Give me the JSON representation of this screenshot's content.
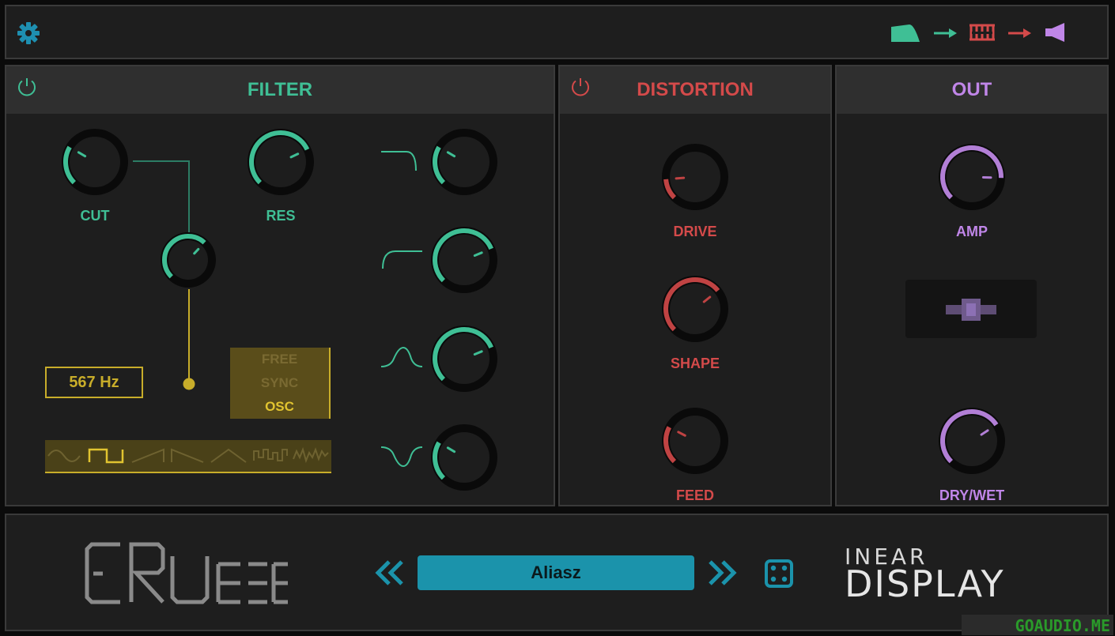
{
  "app": {
    "settings_icon": "gear-icon",
    "routing": [
      "filter-shape-icon",
      "arrow-right-icon",
      "distortion-comb-icon",
      "arrow-right-icon",
      "speaker-icon"
    ]
  },
  "filter": {
    "title": "FILTER",
    "power_icon": "power-icon",
    "cut_label": "CUT",
    "res_label": "RES",
    "cut_value": 0.28,
    "res_value": 0.74,
    "mod_amount": 0.66,
    "freq_display": "567 Hz",
    "mode_options": [
      "FREE",
      "SYNC",
      "OSC"
    ],
    "mode_selected": "OSC",
    "waveforms": [
      "sine",
      "square",
      "saw-up",
      "saw-down",
      "triangle",
      "random-steps",
      "noise"
    ],
    "waveform_selected": "square",
    "types": [
      {
        "icon": "lowpass-icon",
        "value": 0.28
      },
      {
        "icon": "highpass-icon",
        "value": 0.75
      },
      {
        "icon": "bandpass-icon",
        "value": 0.75
      },
      {
        "icon": "notch-icon",
        "value": 0.28
      }
    ]
  },
  "distortion": {
    "title": "DISTORTION",
    "power_icon": "power-icon",
    "drive_label": "DRIVE",
    "shape_label": "SHAPE",
    "feed_label": "FEED",
    "drive_value": 0.15,
    "shape_value": 0.69,
    "feed_value": 0.27
  },
  "out": {
    "title": "OUT",
    "amp_label": "AMP",
    "drywet_label": "DRY/WET",
    "amp_value": 0.84,
    "drywet_value": 0.71
  },
  "footer": {
    "product_logo": "CRUSHER",
    "preset_name": "Aliasz",
    "prev_icon": "double-chevron-left-icon",
    "next_icon": "double-chevron-right-icon",
    "random_icon": "dice-icon",
    "brand_top": "INEAR",
    "brand_bottom": "DISPLAY",
    "watermark": "GOAUDIO.ME"
  },
  "colors": {
    "teal": "#3fbf95",
    "red": "#d44a4a",
    "purple": "#c086e8",
    "yellow": "#c8ad2a",
    "preset_bg": "#1b93ab",
    "blue_icon": "#1e8fb0"
  }
}
